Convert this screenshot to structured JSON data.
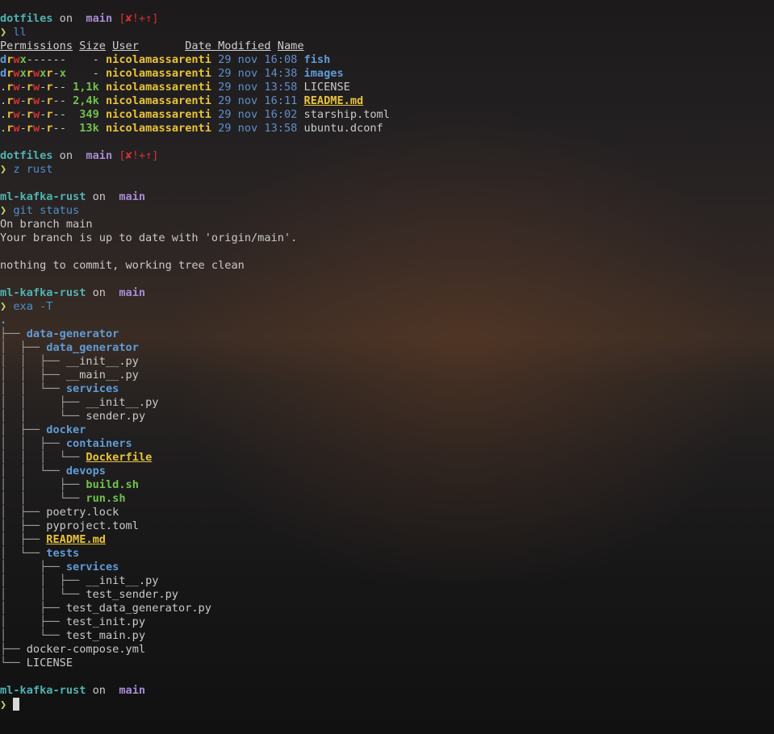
{
  "prompt": {
    "dir1": "dotfiles",
    "on": " on ",
    "branch_icon": "",
    "branch": "main",
    "status": "[✘!+↑]",
    "arrow": "❯",
    "dir2": "ml-kafka-rust"
  },
  "commands": {
    "ll": "ll",
    "z": "z rust",
    "git": "git status",
    "exa": "exa -T"
  },
  "ll": {
    "headers": [
      "Permissions",
      "Size",
      "User",
      "Date Modified",
      "Name"
    ],
    "rows": [
      {
        "perm": "drwx------",
        "size": "-",
        "user": "nicolamassarenti",
        "date": "29 nov 16:08",
        "name": "fish",
        "name_style": "dir"
      },
      {
        "perm": "drwxrwxr-x",
        "size": "-",
        "user": "nicolamassarenti",
        "date": "29 nov 14:38",
        "name": "images",
        "name_style": "dir"
      },
      {
        "perm": ".rw-rw-r--",
        "size": "1,1k",
        "user": "nicolamassarenti",
        "date": "29 nov 13:58",
        "name": "LICENSE",
        "name_style": "plain"
      },
      {
        "perm": ".rw-rw-r--",
        "size": "2,4k",
        "user": "nicolamassarenti",
        "date": "29 nov 16:11",
        "name": "README.md",
        "name_style": "readme"
      },
      {
        "perm": ".rw-rw-r--",
        "size": "349",
        "user": "nicolamassarenti",
        "date": "29 nov 16:02",
        "name": "starship.toml",
        "name_style": "plain"
      },
      {
        "perm": ".rw-rw-r--",
        "size": "13k",
        "user": "nicolamassarenti",
        "date": "29 nov 13:58",
        "name": "ubuntu.dconf",
        "name_style": "plain"
      }
    ]
  },
  "git_status": {
    "line1": "On branch main",
    "line2": "Your branch is up to date with 'origin/main'.",
    "line3": "nothing to commit, working tree clean"
  },
  "tree": [
    {
      "prefix": "",
      "name": ".",
      "style": "dir"
    },
    {
      "prefix": "├── ",
      "name": "data-generator",
      "style": "dir"
    },
    {
      "prefix": "│  ├── ",
      "name": "data_generator",
      "style": "dir"
    },
    {
      "prefix": "│  │  ├── ",
      "name": "__init__.py",
      "style": "plain"
    },
    {
      "prefix": "│  │  ├── ",
      "name": "__main__.py",
      "style": "plain"
    },
    {
      "prefix": "│  │  └── ",
      "name": "services",
      "style": "dir"
    },
    {
      "prefix": "│  │     ├── ",
      "name": "__init__.py",
      "style": "plain"
    },
    {
      "prefix": "│  │     └── ",
      "name": "sender.py",
      "style": "plain"
    },
    {
      "prefix": "│  ├── ",
      "name": "docker",
      "style": "dir"
    },
    {
      "prefix": "│  │  ├── ",
      "name": "containers",
      "style": "dir"
    },
    {
      "prefix": "│  │  │  └── ",
      "name": "Dockerfile",
      "style": "readme"
    },
    {
      "prefix": "│  │  └── ",
      "name": "devops",
      "style": "dir"
    },
    {
      "prefix": "│  │     ├── ",
      "name": "build.sh",
      "style": "exec"
    },
    {
      "prefix": "│  │     └── ",
      "name": "run.sh",
      "style": "exec"
    },
    {
      "prefix": "│  ├── ",
      "name": "poetry.lock",
      "style": "plain"
    },
    {
      "prefix": "│  ├── ",
      "name": "pyproject.toml",
      "style": "plain"
    },
    {
      "prefix": "│  ├── ",
      "name": "README.md",
      "style": "readme"
    },
    {
      "prefix": "│  └── ",
      "name": "tests",
      "style": "dir"
    },
    {
      "prefix": "│     ├── ",
      "name": "services",
      "style": "dir"
    },
    {
      "prefix": "│     │  ├── ",
      "name": "__init__.py",
      "style": "plain"
    },
    {
      "prefix": "│     │  └── ",
      "name": "test_sender.py",
      "style": "plain"
    },
    {
      "prefix": "│     ├── ",
      "name": "test_data_generator.py",
      "style": "plain"
    },
    {
      "prefix": "│     ├── ",
      "name": "test_init.py",
      "style": "plain"
    },
    {
      "prefix": "│     └── ",
      "name": "test_main.py",
      "style": "plain"
    },
    {
      "prefix": "├── ",
      "name": "docker-compose.yml",
      "style": "plain"
    },
    {
      "prefix": "└── ",
      "name": "LICENSE",
      "style": "plain"
    }
  ],
  "colors": {
    "directory": "#5f9bd6",
    "prompt_dir": "#4fb3b0",
    "git_branch": "#a78bd4",
    "git_status": "#d2322f",
    "prompt_arrow": "#c1d66b",
    "command": "#4f8fc9",
    "user": "#e8c33a",
    "size": "#6fc24a"
  }
}
